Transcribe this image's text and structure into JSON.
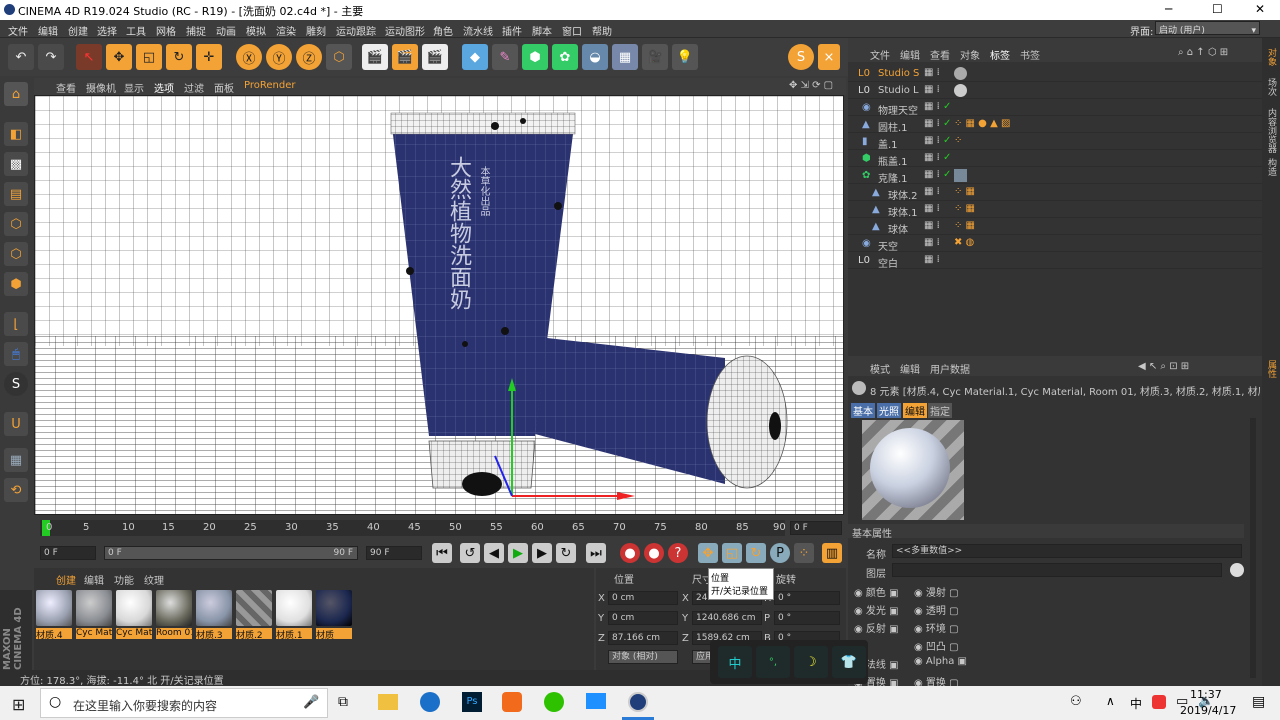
{
  "window": {
    "title": "CINEMA 4D R19.024 Studio (RC - R19) - [洗面奶 02.c4d *] - 主要",
    "minimize": "─",
    "maximize": "☐",
    "close": "✕"
  },
  "menu": [
    "文件",
    "编辑",
    "创建",
    "选择",
    "工具",
    "网格",
    "捕捉",
    "动画",
    "模拟",
    "渲染",
    "雕刻",
    "运动跟踪",
    "运动图形",
    "角色",
    "流水线",
    "插件",
    "脚本",
    "窗口",
    "帮助"
  ],
  "layout": {
    "label": "界面:",
    "value": "启动 (用户)"
  },
  "viewport": {
    "menu": [
      "查看",
      "摄像机",
      "显示",
      "选项",
      "过滤",
      "面板",
      "ProRender"
    ],
    "product_text": "大然植物洗面奶",
    "product_sub": "本草化出品"
  },
  "timeline": {
    "ticks": [
      "0",
      "5",
      "10",
      "15",
      "20",
      "25",
      "30",
      "35",
      "40",
      "45",
      "50",
      "55",
      "60",
      "65",
      "70",
      "75",
      "80",
      "85",
      "90"
    ],
    "current_frame": "0 F",
    "start": "0 F",
    "range_start": "0 F",
    "range_end": "90 F",
    "end": "90 F"
  },
  "tooltip": {
    "title": "位置",
    "desc": "开/关记录位置"
  },
  "materials": {
    "menu": [
      "创建",
      "编辑",
      "功能",
      "纹理"
    ],
    "items": [
      {
        "name": "材质.4",
        "color": "#9aa0b0"
      },
      {
        "name": "Cyc Material.1",
        "color": "#8a8d93"
      },
      {
        "name": "Cyc Material",
        "color": "#d8d8d8"
      },
      {
        "name": "Room 01",
        "color": "#6a6a5e"
      },
      {
        "name": "材质.3",
        "color": "#8894a8"
      },
      {
        "name": "材质.2",
        "color": "#999"
      },
      {
        "name": "材质.1",
        "color": "#e0e0e0"
      },
      {
        "name": "材质",
        "color": "#1c2850"
      }
    ]
  },
  "coords": {
    "headers": [
      "位置",
      "尺寸",
      "旋转"
    ],
    "rows": [
      {
        "axis": "X",
        "pos": "0 cm",
        "size": "246...",
        "rot_axis": "H",
        "rot": "0 °"
      },
      {
        "axis": "Y",
        "pos": "0 cm",
        "size": "1240.686 cm",
        "rot_axis": "P",
        "rot": "0 °"
      },
      {
        "axis": "Z",
        "pos": "87.166 cm",
        "size": "1589.62 cm",
        "rot_axis": "B",
        "rot": "0 °"
      }
    ],
    "mode": "对象 (相对)",
    "apply": "应用"
  },
  "status": "方位: 178.3°, 海拔: -11.4° 北     开/关记录位置",
  "objects": {
    "menu": [
      "文件",
      "编辑",
      "查看",
      "对象",
      "标签",
      "书签"
    ],
    "items": [
      {
        "name": "Studio S",
        "indent": 0,
        "active": true
      },
      {
        "name": "Studio L",
        "indent": 0,
        "active": false
      },
      {
        "name": "物理天空",
        "indent": 0,
        "active": false
      },
      {
        "name": "圆柱.1",
        "indent": 0,
        "active": false
      },
      {
        "name": "盖.1",
        "indent": 0,
        "active": false
      },
      {
        "name": "瓶盖.1",
        "indent": 0,
        "active": false
      },
      {
        "name": "克隆.1",
        "indent": 0,
        "active": false
      },
      {
        "name": "球体.2",
        "indent": 1,
        "active": false
      },
      {
        "name": "球体.1",
        "indent": 1,
        "active": false
      },
      {
        "name": "球体",
        "indent": 1,
        "active": false
      },
      {
        "name": "天空",
        "indent": 0,
        "active": false
      },
      {
        "name": "空白",
        "indent": 0,
        "active": false
      }
    ]
  },
  "attributes": {
    "menu": [
      "模式",
      "编辑",
      "用户数据"
    ],
    "summary": "8 元素 [材质.4, Cyc Material.1, Cyc Material, Room 01, 材质.3, 材质.2, 材质.1, 材质]",
    "tabs": [
      "基本",
      "光照",
      "编辑",
      "指定"
    ],
    "section": "基本属性",
    "name_label": "名称",
    "name_value": "<<多重数值>>",
    "layer_label": "图层",
    "channels_left": [
      "颜色",
      "发光",
      "反射",
      "法线",
      "置换"
    ],
    "channels_right": [
      "漫射",
      "透明",
      "环境",
      "凹凸",
      "Alpha",
      "置换"
    ]
  },
  "ime": [
    "中",
    "°,",
    "☽",
    "👕"
  ],
  "right_tabs": [
    "对象",
    "场次",
    "内容浏览器",
    "构造",
    "属性"
  ],
  "taskbar": {
    "search": "在这里输入你要搜索的内容",
    "time": "11:37",
    "date": "2019/4/17",
    "ime": "中"
  },
  "brand": "MAXON CINEMA 4D"
}
